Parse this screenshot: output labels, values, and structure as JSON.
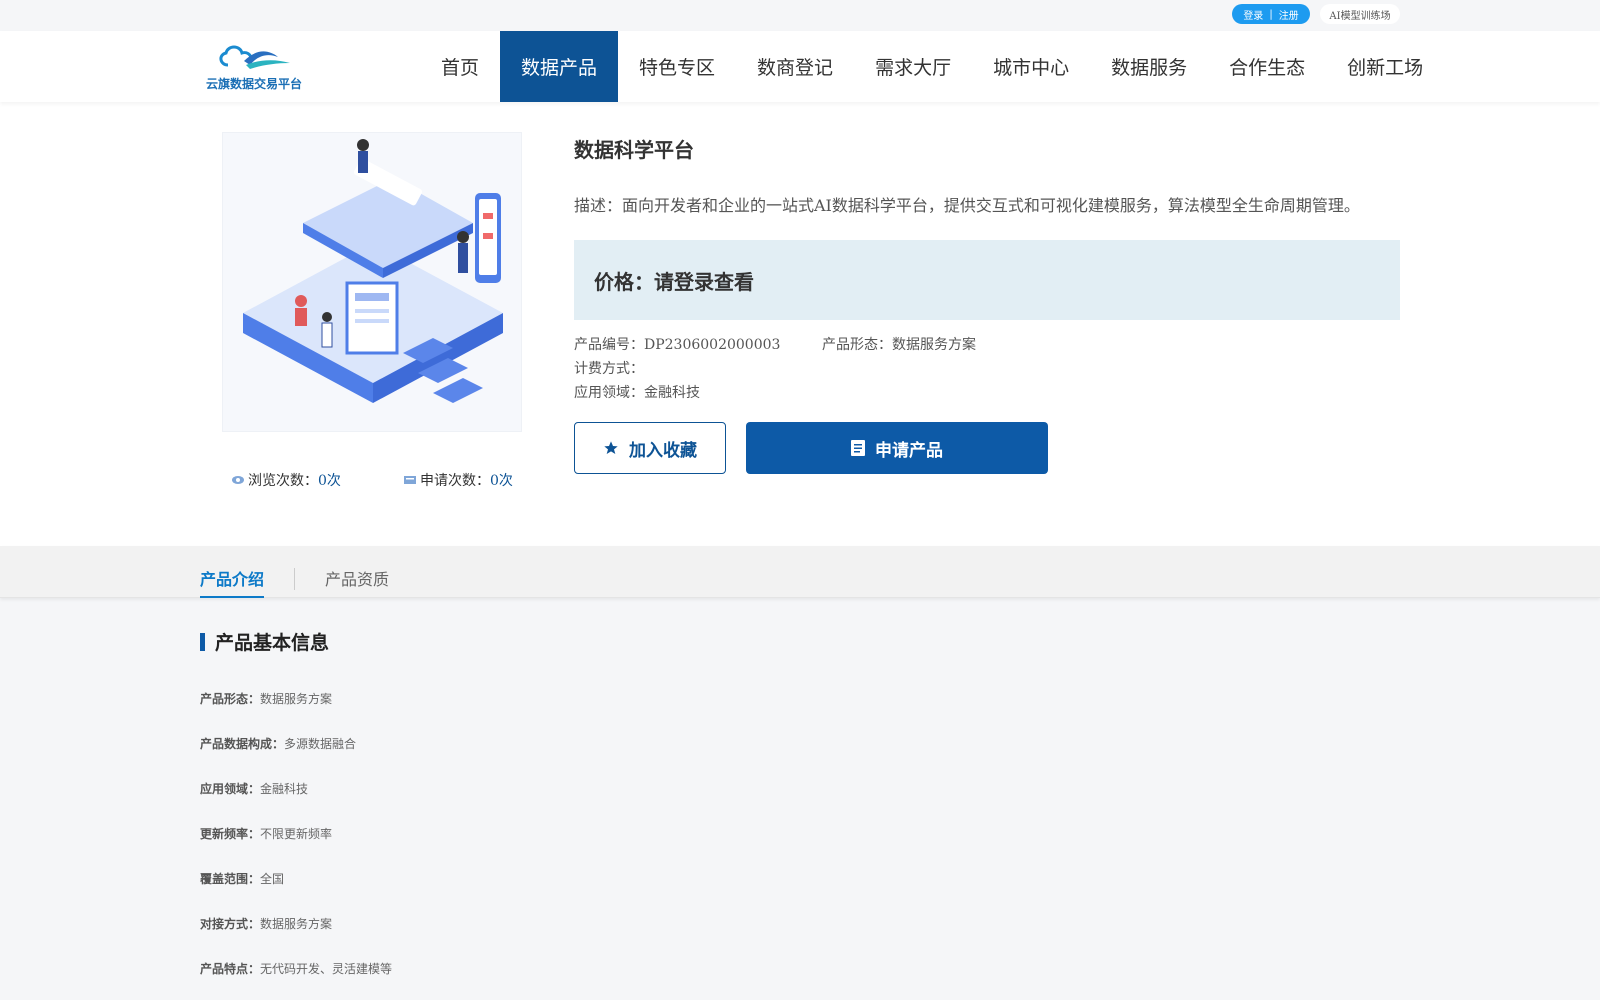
{
  "topbar": {
    "login": "登录",
    "separator": "|",
    "register": "注册",
    "ai_link": "AI模型训练场"
  },
  "header": {
    "logo_text": "云旗数据交易平台",
    "nav": [
      "首页",
      "数据产品",
      "特色专区",
      "数商登记",
      "需求大厅",
      "城市中心",
      "数据服务",
      "合作生态",
      "创新工场"
    ],
    "active_nav": "数据产品"
  },
  "product": {
    "title": "数据科学平台",
    "description": "描述：面向开发者和企业的一站式AI数据科学平台，提供交互式和可视化建模服务，算法模型全生命周期管理。",
    "price": "价格：请登录查看",
    "code_label": "产品编号：",
    "code": "DP2306002000003",
    "form_label": "产品形态：",
    "form": "数据服务方案",
    "billing_label": "计费方式：",
    "billing": "",
    "domain_label": "应用领域：",
    "domain": "金融科技",
    "views_label": "浏览次数：",
    "views": "0次",
    "applies_label": "申请次数：",
    "applies": "0次",
    "favorite_button": "加入收藏",
    "apply_button": "申请产品"
  },
  "tabs": [
    "产品介绍",
    "产品资质"
  ],
  "basic_info": {
    "heading": "产品基本信息",
    "rows": [
      {
        "k": "产品形态：",
        "v": "数据服务方案"
      },
      {
        "k": "产品数据构成：",
        "v": "多源数据融合"
      },
      {
        "k": "应用领域：",
        "v": "金融科技"
      },
      {
        "k": "更新频率：",
        "v": "不限更新频率"
      },
      {
        "k": "覆盖范围：",
        "v": "全国"
      },
      {
        "k": "对接方式：",
        "v": "数据服务方案"
      },
      {
        "k": "产品特点：",
        "v": "无代码开发、灵活建模等"
      }
    ]
  },
  "colors": {
    "primary": "#0d5395",
    "button": "#0d5aa7",
    "price_bg": "#e2eef4",
    "tab_active": "#0d7ac8",
    "login_pill": "#1d9bf0"
  }
}
